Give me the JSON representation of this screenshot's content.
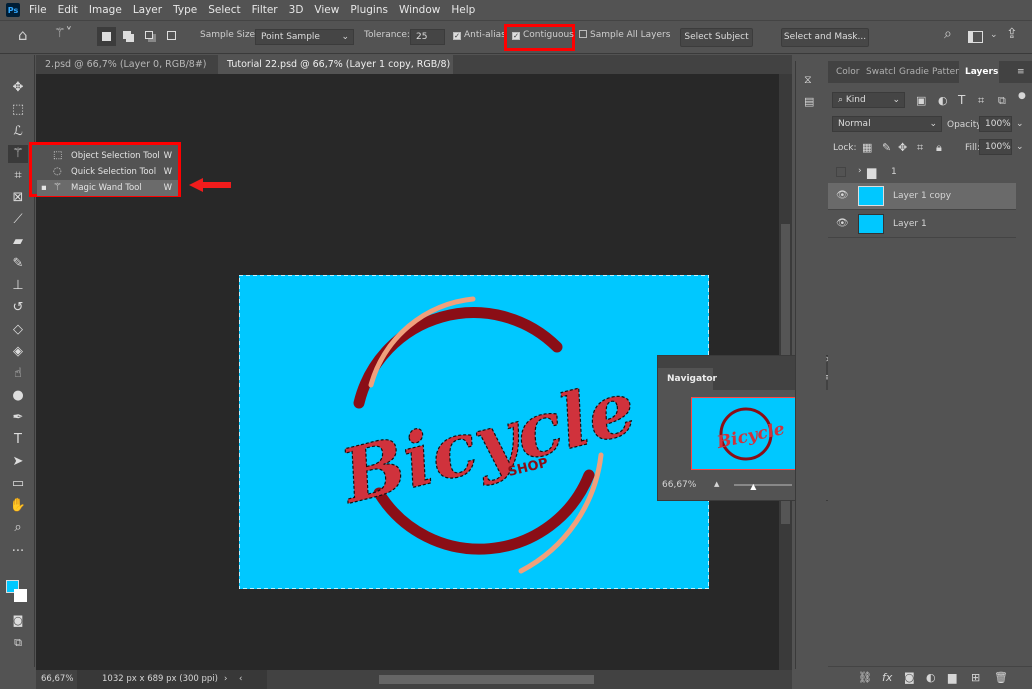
{
  "app": {
    "logo": "Ps"
  },
  "menu": [
    "File",
    "Edit",
    "Image",
    "Layer",
    "Type",
    "Select",
    "Filter",
    "3D",
    "View",
    "Plugins",
    "Window",
    "Help"
  ],
  "options": {
    "sample_size_label": "Sample Size:",
    "sample_size_value": "Point Sample",
    "tolerance_label": "Tolerance:",
    "tolerance_value": "25",
    "anti_alias": "Anti-alias",
    "contiguous": "Contiguous",
    "sample_all_layers": "Sample All Layers",
    "select_subject": "Select Subject",
    "select_and_mask": "Select and Mask..."
  },
  "tabs": [
    {
      "label": "2.psd @ 66,7% (Layer 0, RGB/8#) *"
    },
    {
      "label": "Tutorial 22.psd @ 66,7% (Layer 1 copy, RGB/8) *"
    }
  ],
  "flyout": [
    {
      "label": "Object Selection Tool",
      "key": "W"
    },
    {
      "label": "Quick Selection Tool",
      "key": "W"
    },
    {
      "label": "Magic Wand Tool",
      "key": "W"
    }
  ],
  "canvas": {
    "logo_text": "Bicycle",
    "logo_sub": "SHOP",
    "bg": "#00c8ff",
    "accent": "#d0323c"
  },
  "status": {
    "zoom": "66,67%",
    "doc_info": "1032 px x 689 px (300 ppi)"
  },
  "panel": {
    "tabs": [
      "Color",
      "Swatcl",
      "Gradie",
      "Patten",
      "Layers"
    ],
    "kind": "Kind",
    "blend": "Normal",
    "opacity_label": "Opacity:",
    "opacity": "100%",
    "lock_label": "Lock:",
    "fill_label": "Fill:",
    "fill": "100%",
    "layers": [
      {
        "name": "1"
      },
      {
        "name": "Layer 1 copy"
      },
      {
        "name": "Layer 1"
      }
    ]
  },
  "navigator": {
    "title": "Navigator",
    "zoom": "66,67%",
    "zoom_fraction": 0.35
  }
}
